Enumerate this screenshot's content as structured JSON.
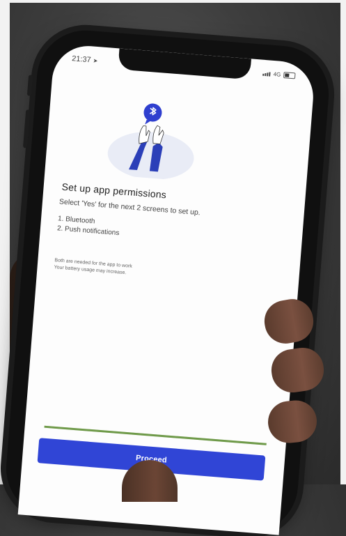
{
  "status_bar": {
    "time": "21:37",
    "network": "4G"
  },
  "permissions": {
    "title": "Set up app permissions",
    "subtitle": "Select 'Yes' for the next 2 screens to set up.",
    "items": [
      "1. Bluetooth",
      "2. Push notifications"
    ],
    "note_line1": "Both are needed for the app to work",
    "note_line2": "Your battery usage may increase."
  },
  "progress": {
    "fraction": 1.0
  },
  "actions": {
    "proceed_label": "Proceed"
  },
  "colors": {
    "accent": "#3045d6",
    "bluetooth_bubble": "#2f3fcf",
    "progress": "#6f9a4a"
  },
  "icons": {
    "bluetooth": "bluetooth-icon",
    "location": "location-arrow-icon"
  }
}
